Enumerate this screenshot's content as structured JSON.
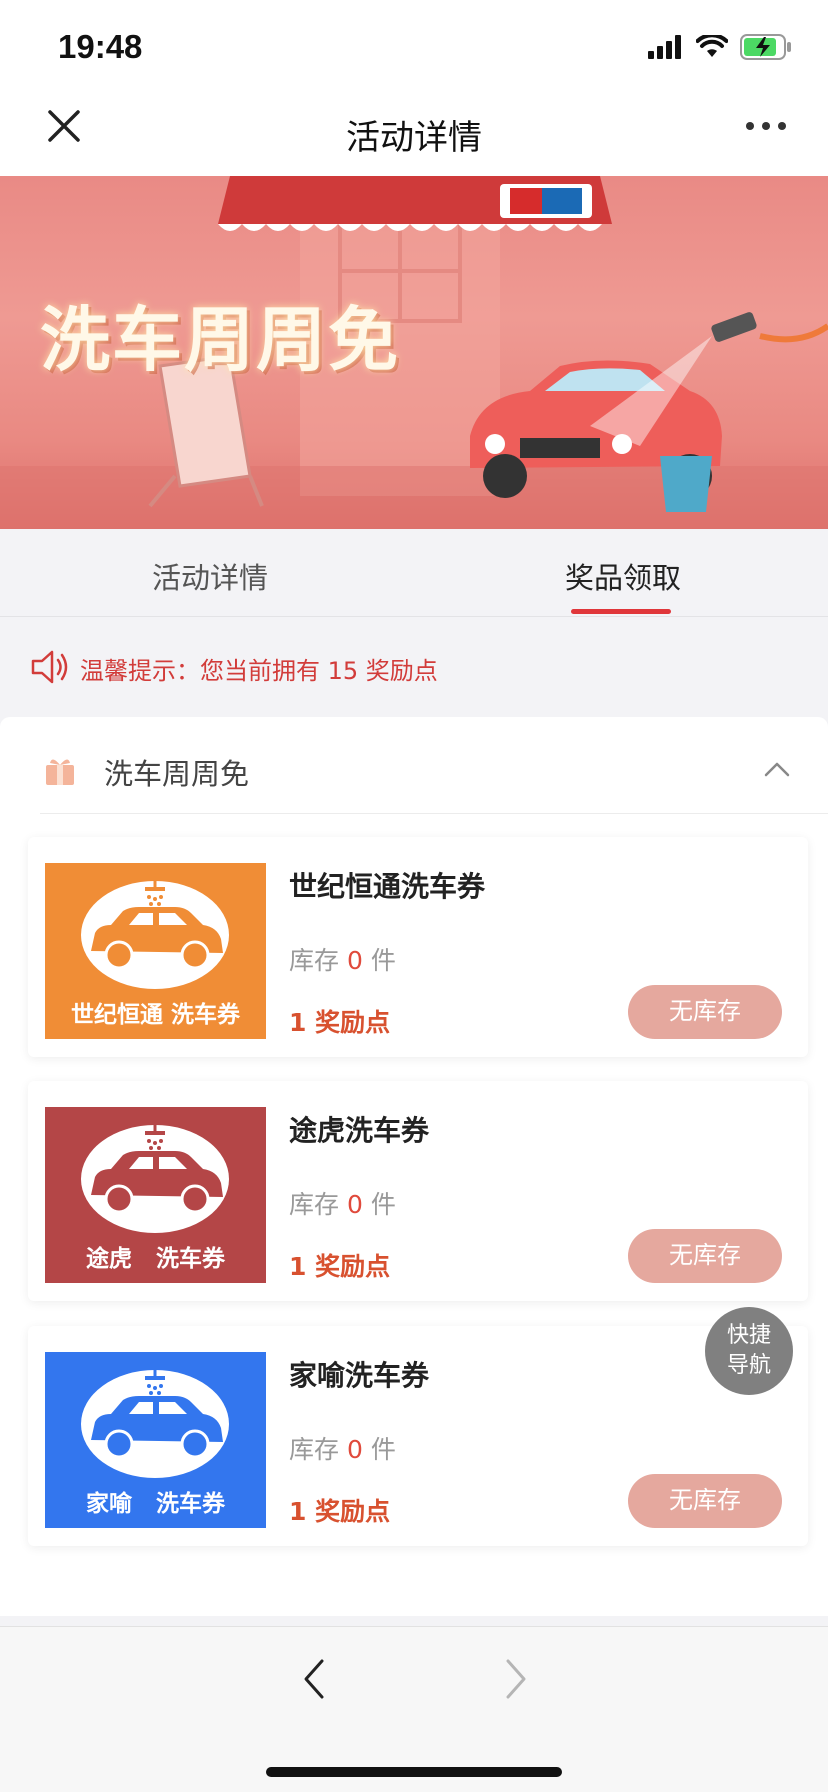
{
  "status_bar": {
    "time": "19:48"
  },
  "nav": {
    "title": "活动详情"
  },
  "banner": {
    "title": "洗车周周免"
  },
  "tabs": [
    {
      "label": "活动详情",
      "active": false
    },
    {
      "label": "奖品领取",
      "active": true
    }
  ],
  "notice": {
    "text": "温馨提示：您当前拥有 15 奖励点"
  },
  "section": {
    "title": "洗车周周免"
  },
  "prizes": [
    {
      "name": "世纪恒通洗车券",
      "thumb_caption": "世纪恒通 洗车券",
      "thumb_color": "#f08d36",
      "car_color": "#f08d36",
      "stock_prefix": "库存",
      "stock": "0",
      "stock_unit": "件",
      "points": "1 奖励点",
      "button": "无库存"
    },
    {
      "name": "途虎洗车券",
      "thumb_caption": "途虎   洗车券",
      "thumb_color": "#b44647",
      "car_color": "#b44647",
      "stock_prefix": "库存",
      "stock": "0",
      "stock_unit": "件",
      "points": "1 奖励点",
      "button": "无库存"
    },
    {
      "name": "家喻洗车券",
      "thumb_caption": "家喻   洗车券",
      "thumb_color": "#3376ee",
      "car_color": "#3376ee",
      "stock_prefix": "库存",
      "stock": "0",
      "stock_unit": "件",
      "points": "1 奖励点",
      "button": "无库存"
    }
  ],
  "quick_nav": {
    "line1": "快捷",
    "line2": "导航"
  },
  "colors": {
    "accent": "#e0363a",
    "notice": "#d23c3a",
    "button": "#e5a89e"
  }
}
